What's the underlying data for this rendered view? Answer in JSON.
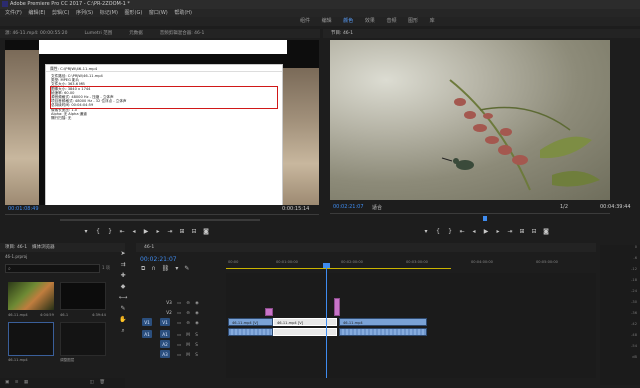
{
  "app": {
    "title": "Adobe Premiere Pro CC 2017 - C:\\PR-2ZOOM-1 *"
  },
  "menus": [
    "文件(F)",
    "编辑(E)",
    "剪辑(C)",
    "序列(S)",
    "标记(M)",
    "图形(G)",
    "窗口(W)",
    "帮助(H)"
  ],
  "workspaces": [
    "组件",
    "编辑",
    "颜色",
    "效果",
    "音频",
    "图形",
    "库"
  ],
  "active_workspace_index": 2,
  "source": {
    "tabs": [
      "源: 46-11.mp4: 00:00:55:20",
      "Lumetri 范围",
      "元数据",
      "音频剪辑混合器: 46-1"
    ],
    "timecode": "00:01:08:49",
    "duration": "0:00:15:14"
  },
  "dialog": {
    "title": "属性: C:\\PRJW\\46-11.mp4",
    "lines": [
      "文件路径: C:\\PRJW\\46-11.mp4",
      "类型: MPEG 影片",
      "文件大小: 363.6 MB",
      "图像大小: 3840 x 1744",
      "帧速率: 60.00",
      "源音频格式: 48000 Hz - 压缩 - 立体声",
      "项目音频格式: 48000 Hz - 32 位浮点 - 立体声",
      "总持续时间: 00:04:04:59",
      "像素长宽比: 1.0",
      "Alpha: 无 Alpha 通道",
      "隔行扫描: 无"
    ],
    "highlight_rows": [
      3,
      4,
      5,
      6,
      7
    ]
  },
  "program": {
    "tab": "节目: 46-1",
    "timecode": "00:02:21:07",
    "fit": "适合",
    "scale": "1/2",
    "duration": "00:04:39:44"
  },
  "project": {
    "tabs": [
      "项目: 46-1",
      "媒体浏览器"
    ],
    "file": "46-1.prproj",
    "count": "1 项",
    "items": [
      {
        "name": "46-11.mp4",
        "duration": "4:04:59"
      },
      {
        "name": "46-1",
        "duration": "4:39:44"
      },
      {
        "name": "46-11.mp4",
        "duration": ""
      },
      {
        "name": "调整图层",
        "duration": ""
      }
    ]
  },
  "timeline": {
    "tab": "46-1",
    "timecode": "00:02:21:07",
    "ruler": [
      "00:00",
      "00:01:00:00",
      "00:02:00:00",
      "00:03:00:00",
      "00:04:00:00",
      "00:05:00:00"
    ],
    "video_tracks": [
      "V3",
      "V2",
      "V1"
    ],
    "audio_tracks": [
      "A1",
      "A2",
      "A3"
    ],
    "clips": [
      {
        "track": "V1",
        "label": "46-11.mp4 [V]"
      },
      {
        "track": "V1",
        "label": "46-11.mp4 [V]"
      },
      {
        "track": "V1",
        "label": "46-11.mp4"
      },
      {
        "track": "A1",
        "label": ""
      }
    ],
    "meter_labels": [
      "0",
      "-6",
      "-12",
      "-18",
      "-24",
      "-30",
      "-36",
      "-42",
      "-48",
      "-54",
      "dB"
    ]
  },
  "colors": {
    "accent": "#3f8cf0",
    "highlight": "#d01818",
    "clip": "#7aa2d6",
    "marker": "#c874c8"
  }
}
